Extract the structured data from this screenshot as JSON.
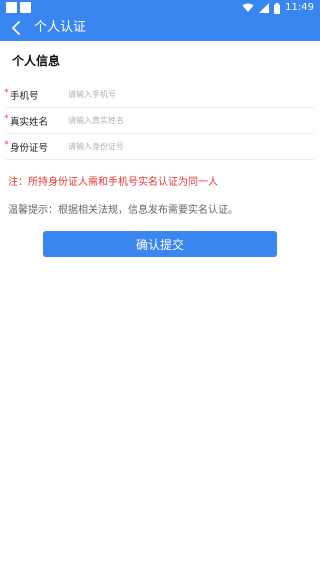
{
  "status_bar": {
    "time": "11:49",
    "icons": [
      "wifi-icon",
      "signal-icon",
      "battery-icon"
    ]
  },
  "app_bar": {
    "title": "个人认证",
    "back_icon": "back-arrow-icon"
  },
  "section": {
    "title": "个人信息"
  },
  "form": {
    "fields": [
      {
        "required_mark": "*",
        "label": "手机号",
        "placeholder": "请输入手机号",
        "value": ""
      },
      {
        "required_mark": "*",
        "label": "真实姓名",
        "placeholder": "请输入真实姓名",
        "value": ""
      },
      {
        "required_mark": "*",
        "label": "身份证号",
        "placeholder": "请输入身份证号",
        "value": ""
      }
    ]
  },
  "note": "注：所持身份证人需和手机号实名认证为同一人",
  "tip": "温馨提示：根据相关法规，信息发布需要实名认证。",
  "submit_label": "确认提交",
  "colors": {
    "primary": "#3a86f0",
    "required": "#e53935",
    "note": "#e53935",
    "tip": "#666666"
  }
}
